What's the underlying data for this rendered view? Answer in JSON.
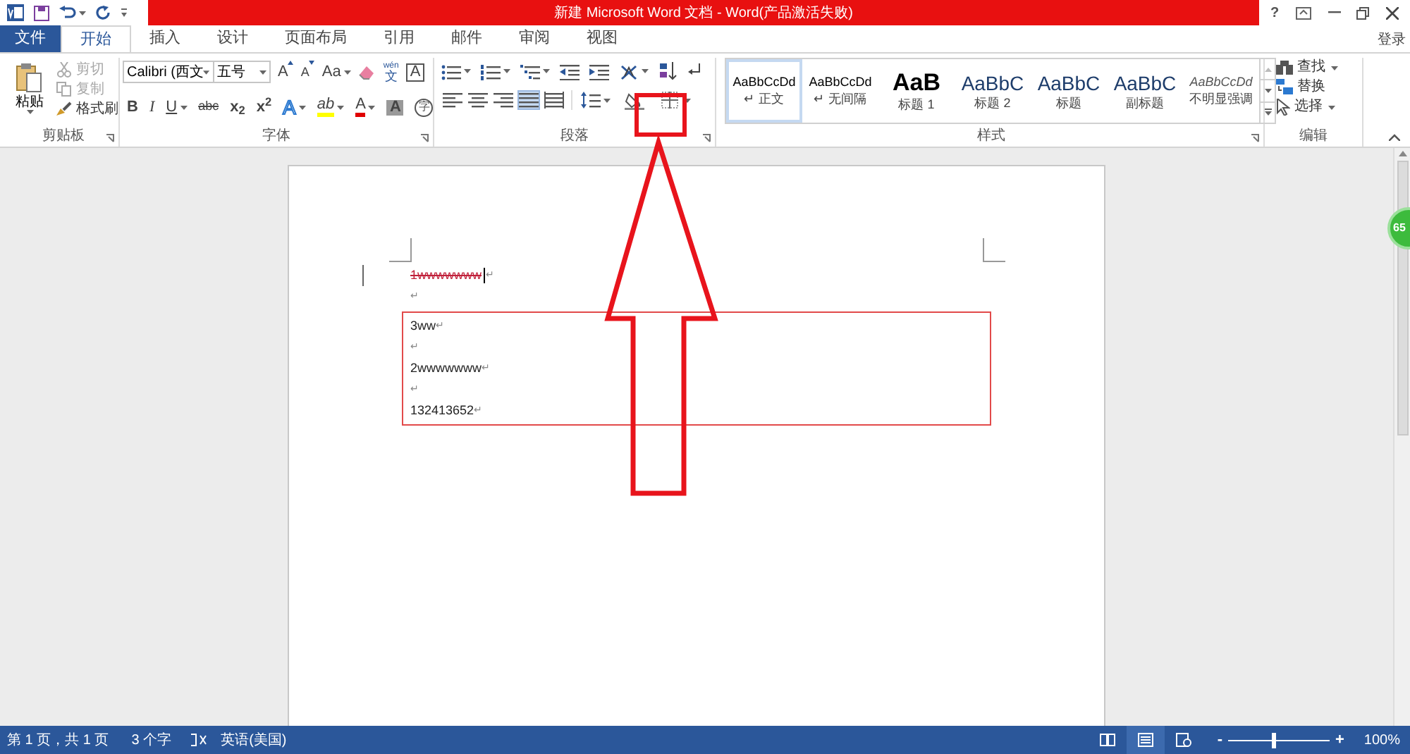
{
  "title_bar": {
    "title": "新建 Microsoft Word 文档 -  Word(产品激活失败)",
    "help": "?"
  },
  "tabs": [
    {
      "label": "文件",
      "kind": "file",
      "selected": false
    },
    {
      "label": "开始",
      "kind": "tab",
      "selected": true
    },
    {
      "label": "插入",
      "kind": "tab",
      "selected": false
    },
    {
      "label": "设计",
      "kind": "tab",
      "selected": false
    },
    {
      "label": "页面布局",
      "kind": "tab",
      "selected": false
    },
    {
      "label": "引用",
      "kind": "tab",
      "selected": false
    },
    {
      "label": "邮件",
      "kind": "tab",
      "selected": false
    },
    {
      "label": "审阅",
      "kind": "tab",
      "selected": false
    },
    {
      "label": "视图",
      "kind": "tab",
      "selected": false
    }
  ],
  "sign_in": "登录",
  "ribbon": {
    "clipboard": {
      "label": "剪贴板",
      "paste": "粘贴",
      "items": [
        {
          "label": "剪切",
          "kind": "cut",
          "disabled": true
        },
        {
          "label": "复制",
          "kind": "copy",
          "disabled": true
        },
        {
          "label": "格式刷",
          "kind": "painter",
          "disabled": false
        }
      ]
    },
    "font": {
      "label": "字体",
      "font_name": "Calibri (西文",
      "font_size": "五号",
      "row1": [
        {
          "glyph": "A",
          "kind": "grow"
        },
        {
          "glyph": "A",
          "kind": "shrink"
        },
        {
          "glyph": "Aa",
          "kind": "case"
        },
        {
          "kind": "clear"
        },
        {
          "glyph": "文",
          "ruby": "wén",
          "kind": "phonetic"
        },
        {
          "glyph": "A",
          "kind": "bordered"
        }
      ],
      "row2": [
        {
          "glyph": "B",
          "kind": "bold"
        },
        {
          "glyph": "I",
          "kind": "italic"
        },
        {
          "glyph": "U",
          "kind": "underline"
        },
        {
          "glyph": "abc",
          "kind": "strike"
        },
        {
          "glyph": "x$_{2}$",
          "kind": "script"
        },
        {
          "glyph": "x$^{2}$",
          "kind": "script"
        },
        {
          "glyph": "A",
          "kind": "effect"
        },
        {
          "glyph": "ab",
          "kind": "highlight"
        },
        {
          "glyph": "A",
          "kind": "color"
        },
        {
          "glyph": "A",
          "kind": "shaded"
        },
        {
          "glyph": "字",
          "kind": "circled"
        }
      ]
    },
    "paragraph": {
      "label": "段落",
      "row1": [
        {
          "kind": "bullets"
        },
        {
          "kind": "numbering"
        },
        {
          "kind": "multilevel"
        },
        {
          "kind": "outdent"
        },
        {
          "kind": "indent"
        },
        {
          "kind": "asian"
        },
        {
          "kind": "sort"
        },
        {
          "kind": "marks"
        }
      ],
      "alignments": [
        {
          "kind": "left",
          "selected": false
        },
        {
          "kind": "center",
          "selected": false
        },
        {
          "kind": "right",
          "selected": false
        },
        {
          "kind": "justify",
          "selected": true
        },
        {
          "kind": "distributed",
          "selected": false
        }
      ],
      "tools": [
        {
          "kind": "spacing"
        },
        {
          "kind": "shading"
        },
        {
          "kind": "borders"
        }
      ]
    },
    "styles": {
      "label": "样式",
      "items": [
        {
          "preview": "AaBbCcDd",
          "name": "↵ 正文",
          "kind": "normal",
          "selected": true
        },
        {
          "preview": "AaBbCcDd",
          "name": "↵ 无间隔",
          "kind": "normal",
          "selected": false
        },
        {
          "preview": "AaB",
          "name": "标题 1",
          "kind": "h1",
          "selected": false
        },
        {
          "preview": "AaBbC",
          "name": "标题 2",
          "kind": "h2",
          "selected": false
        },
        {
          "preview": "AaBbC",
          "name": "标题",
          "kind": "h2",
          "selected": false
        },
        {
          "preview": "AaBbC",
          "name": "副标题",
          "kind": "h2",
          "selected": false
        },
        {
          "preview": "AaBbCcDd",
          "name": "不明显强调",
          "kind": "emphasis",
          "selected": false
        }
      ]
    },
    "editing": {
      "label": "编辑",
      "items": [
        {
          "label": "查找",
          "kind": "find"
        },
        {
          "label": "替换",
          "kind": "replace"
        },
        {
          "label": "选择",
          "kind": "select"
        }
      ]
    }
  },
  "document": {
    "paragraphs": [
      {
        "text": "1wwwwwww",
        "mark": "↵",
        "strike": true
      },
      {
        "mark": "↵",
        "strike": false
      }
    ],
    "bordered_block": [
      {
        "text": "3ww",
        "mark": "↵"
      },
      {
        "mark": "↵"
      },
      {
        "text": "2wwwwwww",
        "mark": "↵"
      },
      {
        "mark": "↵"
      },
      {
        "text": "132413652",
        "mark": "↵"
      }
    ]
  },
  "floating_badge": "65",
  "status_bar": {
    "page": "第 1 页，共 1 页",
    "words": "3 个字",
    "language": "英语(美国)",
    "views": [
      {
        "kind": "read",
        "selected": false
      },
      {
        "kind": "print",
        "selected": true
      },
      {
        "kind": "web",
        "selected": false
      }
    ],
    "zoom_out": "-",
    "zoom": {
      "level": 0.45
    },
    "zoom_in": "+",
    "zoom_percent": "100%"
  }
}
